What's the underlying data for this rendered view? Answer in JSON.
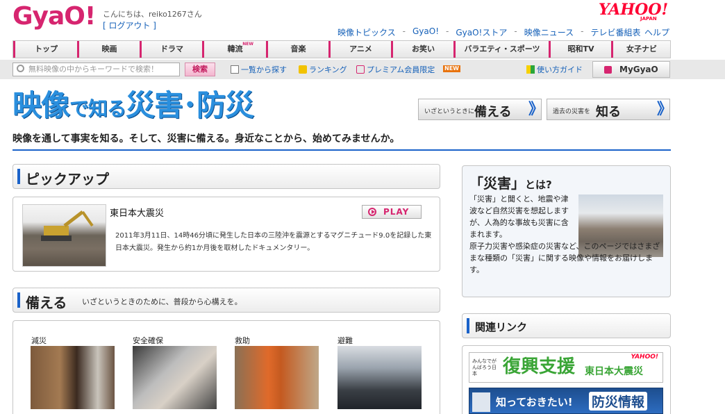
{
  "header": {
    "logo": "GyaO!",
    "greeting": "こんにちは、reiko1267さん",
    "logout": "[ ログアウト ]",
    "yahoo_logo": "YAHOO!",
    "yahoo_japan": "JAPAN",
    "links": [
      "映像トピックス",
      "GyaO!",
      "GyaO!ストア",
      "映像ニュース",
      "テレビ番組表"
    ],
    "separator": "-",
    "help": "ヘルプ"
  },
  "nav": {
    "items": [
      {
        "label": "トップ"
      },
      {
        "label": "映画"
      },
      {
        "label": "ドラマ"
      },
      {
        "label": "韓流",
        "badge": "NEW"
      },
      {
        "label": "音楽"
      },
      {
        "label": "アニメ"
      },
      {
        "label": "お笑い"
      },
      {
        "label": "バラエティ・スポーツ"
      },
      {
        "label": "昭和TV"
      },
      {
        "label": "女子ナビ"
      }
    ]
  },
  "searchbar": {
    "placeholder": "無料映像の中からキーワードで検索！",
    "button": "検索",
    "list_link": "一覧から探す",
    "ranking_link": "ランキング",
    "premium_link": "プレミアム会員限定",
    "new_badge": "NEW",
    "guide_link": "使い方ガイド",
    "mygyao": "MyGyaO"
  },
  "hero": {
    "title_a": "映像",
    "title_b": "で知る",
    "title_c": "災害･防災",
    "subtitle": "映像を通して事実を知る。そして、災害に備える。身近なことから、始めてみませんか。",
    "cta_prepare_pre": "いざというときに",
    "cta_prepare": "備える",
    "cta_know_pre": "過去の災害を",
    "cta_know": "知る",
    "arrow": "》"
  },
  "pickup": {
    "heading": "ピックアップ",
    "title": "東日本大震災",
    "play": "PLAY",
    "description": "2011年3月11日、14時46分頃に発生した日本の三陸沖を震源とするマグニチュード9.0を記録した東日本大震災。発生から約1か月後を取材したドキュメンタリー。"
  },
  "sonaeru": {
    "heading": "備える",
    "subtitle": "いざというときのために、普段から心構えを。",
    "categories": [
      "減災",
      "安全確保",
      "救助",
      "避難"
    ]
  },
  "side": {
    "title_a": "「災害」",
    "title_b": "とは?",
    "desc1": "「災害」と聞くと、地震や津波など自然災害を想起しますが、人為的な事故も災害に含まれます。",
    "desc2": "原子力災害や感染症の災害など、このページではさまざまな種類の「災害」に関する映像や情報をお届けします。"
  },
  "related": {
    "heading": "関連リンク",
    "banner1_small": "みんなでがんばろう日本",
    "banner1_big": "復興支援",
    "banner1_small2": "東日本大震災",
    "banner1_yj": "YAHOO!",
    "banner2_a": "知っておきたい!",
    "banner2_b": "防災情報"
  }
}
